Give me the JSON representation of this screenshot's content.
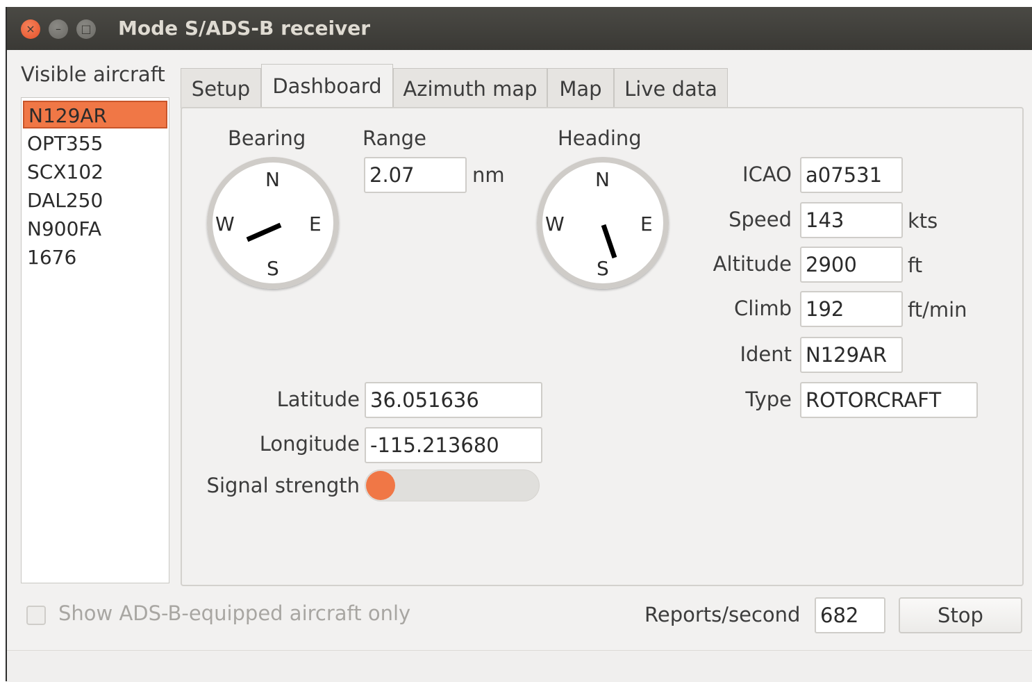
{
  "window": {
    "title": "Mode S/ADS-B receiver",
    "buttons": {
      "close": "×",
      "minimize": "–",
      "maximize": "□"
    }
  },
  "sidebar": {
    "label": "Visible aircraft",
    "items": [
      "N129AR",
      "OPT355",
      "SCX102",
      "DAL250",
      "N900FA",
      "1676"
    ],
    "selected": "N129AR"
  },
  "tabs": [
    "Setup",
    "Dashboard",
    "Azimuth map",
    "Map",
    "Live data"
  ],
  "active_tab": "Dashboard",
  "dashboard": {
    "bearing": {
      "label": "Bearing",
      "N": "N",
      "E": "E",
      "S": "S",
      "W": "W"
    },
    "range": {
      "label": "Range",
      "value": "2.07",
      "unit": "nm"
    },
    "heading": {
      "label": "Heading",
      "N": "N",
      "E": "E",
      "S": "S",
      "W": "W"
    },
    "icao": {
      "label": "ICAO",
      "value": "a07531"
    },
    "speed": {
      "label": "Speed",
      "value": "143",
      "unit": "kts"
    },
    "altitude": {
      "label": "Altitude",
      "value": "2900",
      "unit": "ft"
    },
    "climb": {
      "label": "Climb",
      "value": "192",
      "unit": "ft/min"
    },
    "ident": {
      "label": "Ident",
      "value": "N129AR"
    },
    "type": {
      "label": "Type",
      "value": "ROTORCRAFT"
    },
    "latitude": {
      "label": "Latitude",
      "value": "36.051636"
    },
    "longitude": {
      "label": "Longitude",
      "value": "-115.213680"
    },
    "signal": {
      "label": "Signal strength",
      "level": 0.1
    }
  },
  "footer": {
    "checkbox_label": "Show ADS-B-equipped aircraft only",
    "checked": false,
    "reports_label": "Reports/second",
    "reports_value": "682",
    "stop_label": "Stop"
  },
  "colors": {
    "accent": "#f07746",
    "titlebar": "#3f3e3a",
    "window_bg": "#f2f1f0"
  }
}
